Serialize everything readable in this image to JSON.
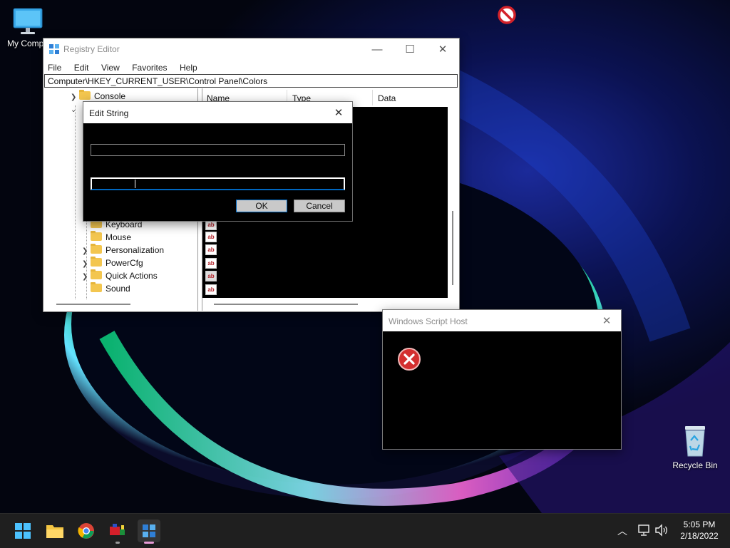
{
  "desktop": {
    "icons": [
      {
        "label": "My Compu"
      },
      {
        "label": "Recycle Bin"
      }
    ]
  },
  "registry_editor": {
    "title": "Registry Editor",
    "menu": [
      "File",
      "Edit",
      "View",
      "Favorites",
      "Help"
    ],
    "address": "Computer\\HKEY_CURRENT_USER\\Control Panel\\Colors",
    "tree": [
      "Console",
      "Keyboard",
      "Mouse",
      "Personalization",
      "PowerCfg",
      "Quick Actions",
      "Sound"
    ],
    "columns": [
      "Name",
      "Type",
      "Data"
    ],
    "value_icon_text": "ab"
  },
  "edit_string": {
    "title": "Edit String",
    "value_name": "",
    "value_data": "",
    "ok_label": "OK",
    "cancel_label": "Cancel"
  },
  "script_host": {
    "title": "Windows Script Host"
  },
  "taskbar": {
    "time": "5:05 PM",
    "date": "2/18/2022"
  },
  "colors": {
    "accent": "#0067c0",
    "error_red": "#d32f2f"
  }
}
